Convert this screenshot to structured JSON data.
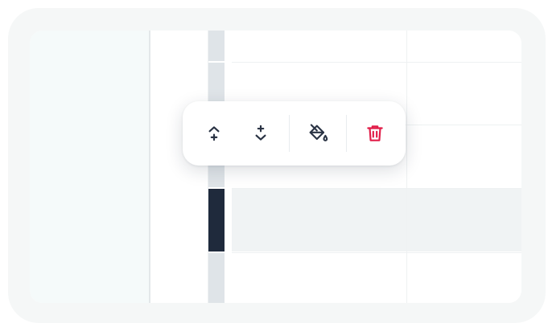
{
  "toolbar": {
    "actions": [
      {
        "name": "insert-row-above",
        "icon": "insert-row-above-icon",
        "color": "#2a3344"
      },
      {
        "name": "insert-row-below",
        "icon": "insert-row-below-icon",
        "color": "#2a3344"
      },
      {
        "name": "fill-color",
        "icon": "paint-bucket-icon",
        "color": "#2a3344"
      },
      {
        "name": "delete-row",
        "icon": "trash-icon",
        "color": "#e11d48"
      }
    ]
  },
  "colors": {
    "frame": "#f5f7f7",
    "left_pane": "#f5fafa",
    "row_handle": "#dfe4e8",
    "row_handle_selected": "#1f2a3c",
    "selected_row": "#f0f3f4",
    "icon": "#2a3344",
    "danger": "#e11d48"
  }
}
